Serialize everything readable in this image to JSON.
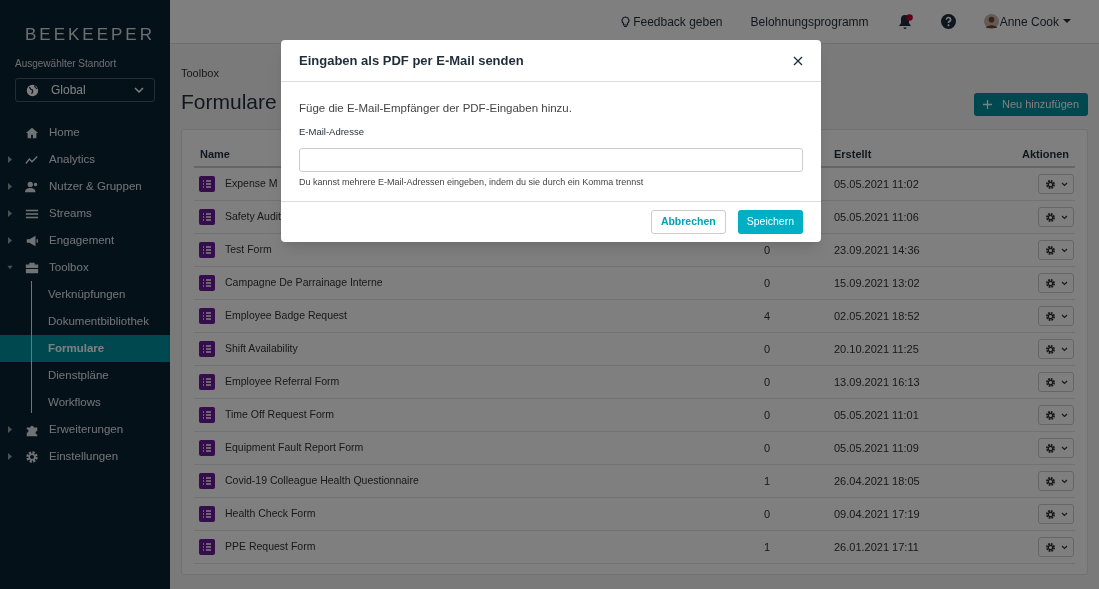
{
  "logo": {
    "text": "BEEKEEPER"
  },
  "location": {
    "label": "Ausgewählter Standort",
    "value": "Global"
  },
  "nav": [
    {
      "label": "Home",
      "selected": false
    },
    {
      "label": "Analytics",
      "expanded": false,
      "selected": false
    },
    {
      "label": "Nutzer & Gruppen",
      "expanded": false,
      "selected": false
    },
    {
      "label": "Streams",
      "expanded": false,
      "selected": false
    },
    {
      "label": "Engagement",
      "expanded": false,
      "selected": false
    },
    {
      "label": "Toolbox",
      "expanded": true,
      "selected": false,
      "children": [
        {
          "label": "Verknüpfungen",
          "selected": false
        },
        {
          "label": "Dokumentbibliothek",
          "selected": false
        },
        {
          "label": "Formulare",
          "selected": true
        },
        {
          "label": "Dienstpläne",
          "selected": false
        },
        {
          "label": "Workflows",
          "selected": false
        }
      ]
    },
    {
      "label": "Erweiterungen",
      "expanded": false,
      "selected": false
    },
    {
      "label": "Einstellungen",
      "expanded": false,
      "selected": false
    }
  ],
  "topbar": {
    "feedback": "Feedback geben",
    "rewards": "Belohnungsprogramm",
    "notifications_unread": true,
    "user": "Anne Cook"
  },
  "breadcrumb": "Toolbox",
  "title": "Formulare",
  "new_button": "Neu hinzufügen",
  "table": {
    "columns": [
      "Name",
      "Erstellt",
      "Aktionen"
    ],
    "rows": [
      {
        "name": "Expense M",
        "created": "05.05.2021 11:02"
      },
      {
        "name": "Safety Audit",
        "created": "05.05.2021 11:06"
      },
      {
        "name": "Test Form",
        "count": "0",
        "created": "23.09.2021 14:36"
      },
      {
        "name": "Campagne De Parrainage Interne",
        "count": "0",
        "created": "15.09.2021 13:02"
      },
      {
        "name": "Employee Badge Request",
        "count": "4",
        "created": "02.05.2021 18:52"
      },
      {
        "name": "Shift Availability",
        "count": "0",
        "created": "20.10.2021 11:25"
      },
      {
        "name": "Employee Referral Form",
        "count": "0",
        "created": "13.09.2021 16:13"
      },
      {
        "name": "Time Off Request Form",
        "count": "0",
        "created": "05.05.2021 11:01"
      },
      {
        "name": "Equipment Fault Report Form",
        "count": "0",
        "created": "05.05.2021 11:09"
      },
      {
        "name": "Covid-19 Colleague Health Questionnaire",
        "count": "1",
        "created": "26.04.2021 18:05"
      },
      {
        "name": "Health Check Form",
        "count": "0",
        "created": "09.04.2021 17:19"
      },
      {
        "name": "PPE Request Form",
        "count": "1",
        "created": "26.01.2021 17:11"
      }
    ]
  },
  "dialog": {
    "title": "Eingaben als PDF per E-Mail senden",
    "intro": "Füge die E-Mail-Empfänger der PDF-Eingaben hinzu.",
    "field_label": "E-Mail-Adresse",
    "hint": "Du kannst mehrere E-Mail-Adressen eingeben, indem du sie durch ein Komma trennst",
    "cancel": "Abbrechen",
    "save": "Speichern"
  }
}
